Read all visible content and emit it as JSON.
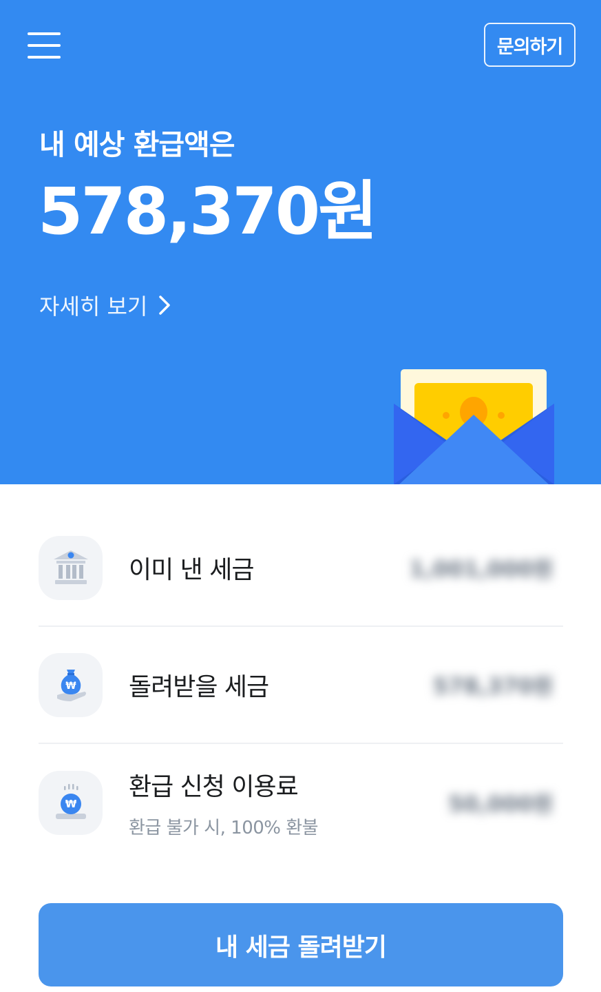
{
  "header": {
    "menu_icon": "hamburger-menu-icon",
    "inquiry_label": "문의하기"
  },
  "hero": {
    "subtitle": "내 예상 환급액은",
    "amount": "578,370원",
    "detail_link": "자세히 보기",
    "illustration": "money-envelope-illustration"
  },
  "tax_items": [
    {
      "icon": "bank-building-icon",
      "label": "이미 낸 세금",
      "note": "",
      "value": "1,001,000원"
    },
    {
      "icon": "money-bag-hand-icon",
      "label": "돌려받을 세금",
      "note": "",
      "value": "578,370원"
    },
    {
      "icon": "won-coin-icon",
      "label": "환급 신청 이용료",
      "note": "환급 불가 시, 100% 환불",
      "value": "50,000원"
    }
  ],
  "cta": {
    "label": "내 세금 돌려받기"
  },
  "colors": {
    "primary": "#338AF1",
    "cta": "#4A95EC",
    "icon_bg": "#F2F4F7",
    "text": "#1B1D1F",
    "muted": "#8B95A1"
  }
}
